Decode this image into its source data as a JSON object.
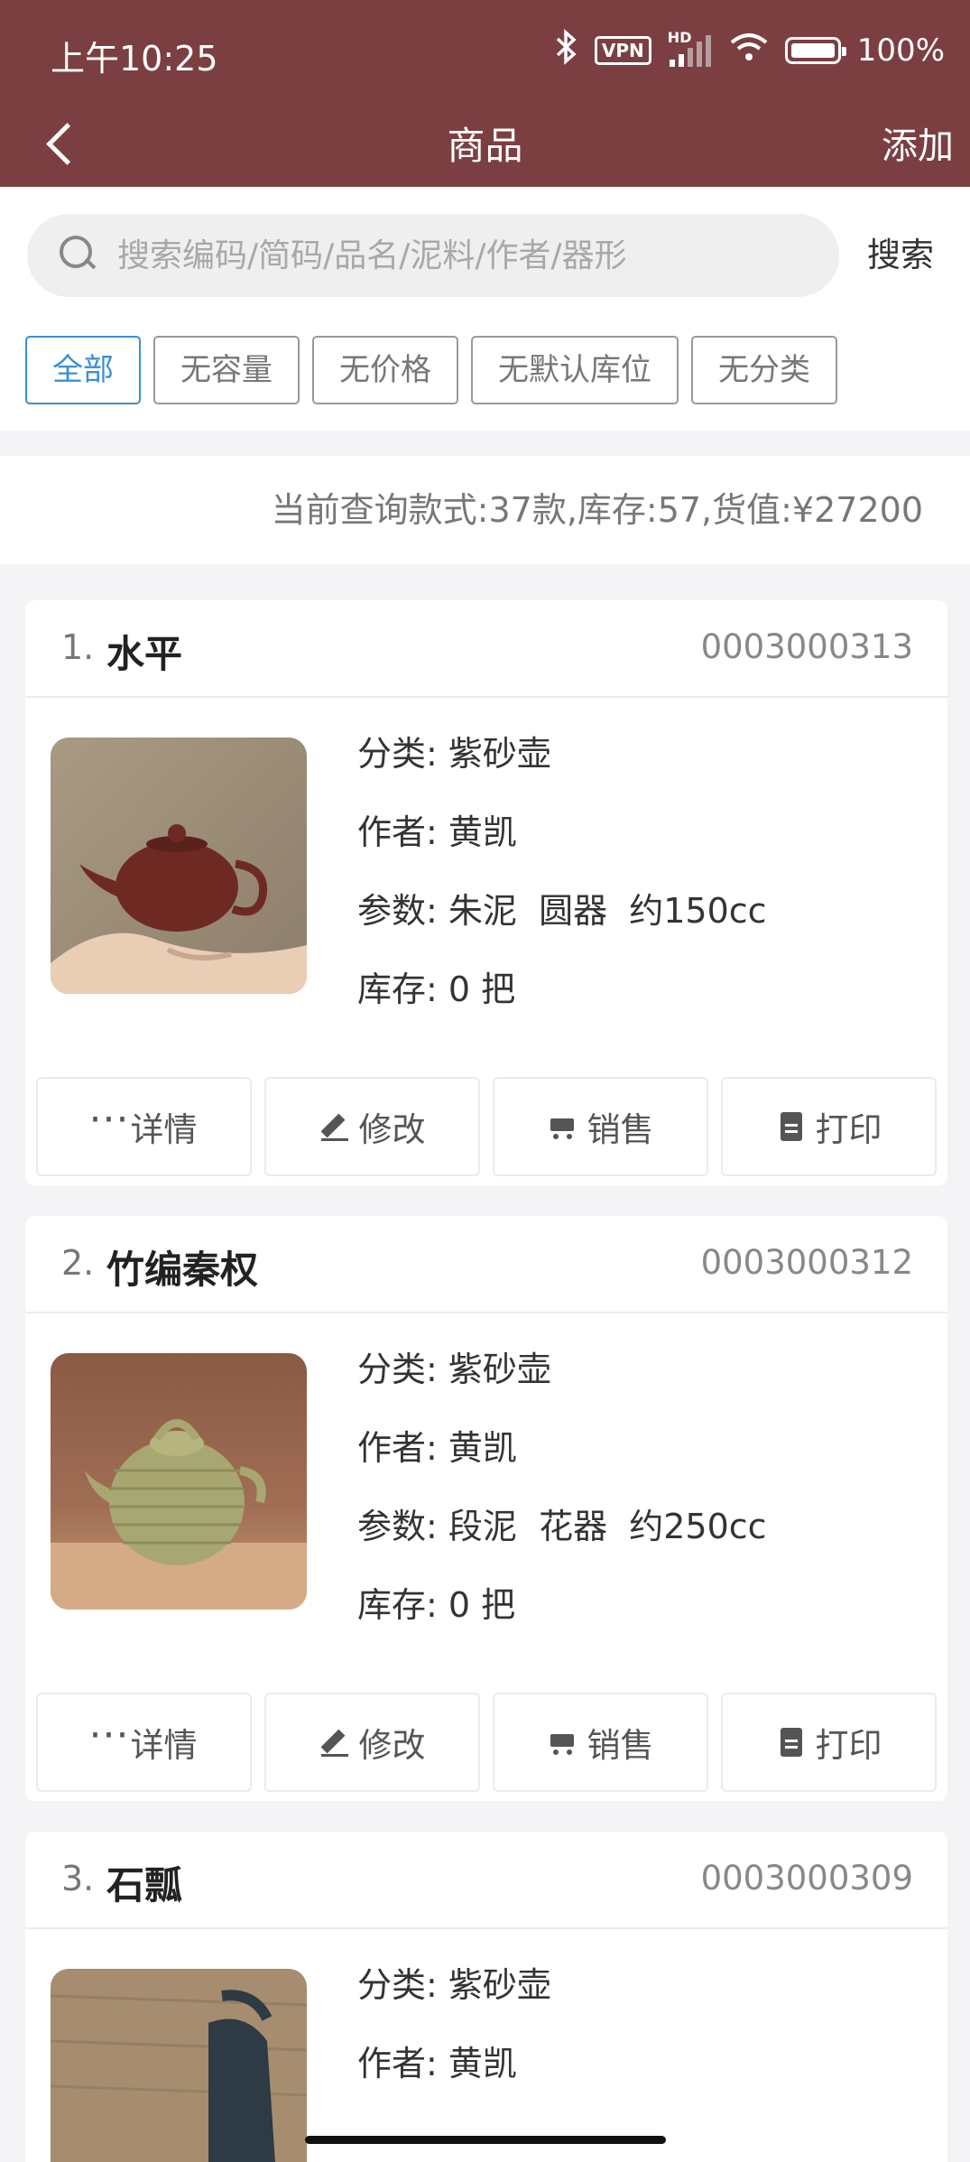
{
  "status_bar": {
    "time": "上午10:25",
    "vpn": "VPN",
    "hd": "HD",
    "battery": "100%"
  },
  "nav": {
    "title": "商品",
    "add_label": "添加"
  },
  "search": {
    "placeholder": "搜索编码/简码/品名/泥料/作者/器形",
    "button_label": "搜索"
  },
  "filters": [
    {
      "label": "全部",
      "active": true
    },
    {
      "label": "无容量",
      "active": false
    },
    {
      "label": "无价格",
      "active": false
    },
    {
      "label": "无默认库位",
      "active": false
    },
    {
      "label": "无分类",
      "active": false
    }
  ],
  "summary": "当前查询款式:37款,库存:57,货值:¥27200",
  "actions": {
    "details": "详情",
    "edit": "修改",
    "sell": "销售",
    "print": "打印"
  },
  "labels": {
    "category": "分类:",
    "author": "作者:",
    "params": "参数:",
    "stock": "库存:"
  },
  "products": [
    {
      "index": "1.",
      "name": "水平",
      "code": "0003000313",
      "category": "紫砂壶",
      "author": "黄凯",
      "params": "朱泥  圆器  约150cc",
      "stock": "0 把"
    },
    {
      "index": "2.",
      "name": "竹编秦权",
      "code": "0003000312",
      "category": "紫砂壶",
      "author": "黄凯",
      "params": "段泥  花器  约250cc",
      "stock": "0 把"
    },
    {
      "index": "3.",
      "name": "石瓢",
      "code": "0003000309",
      "category": "紫砂壶",
      "author": "黄凯"
    }
  ],
  "colors": {
    "header": "#7b3f42",
    "active_chip": "#3a8fd6"
  }
}
